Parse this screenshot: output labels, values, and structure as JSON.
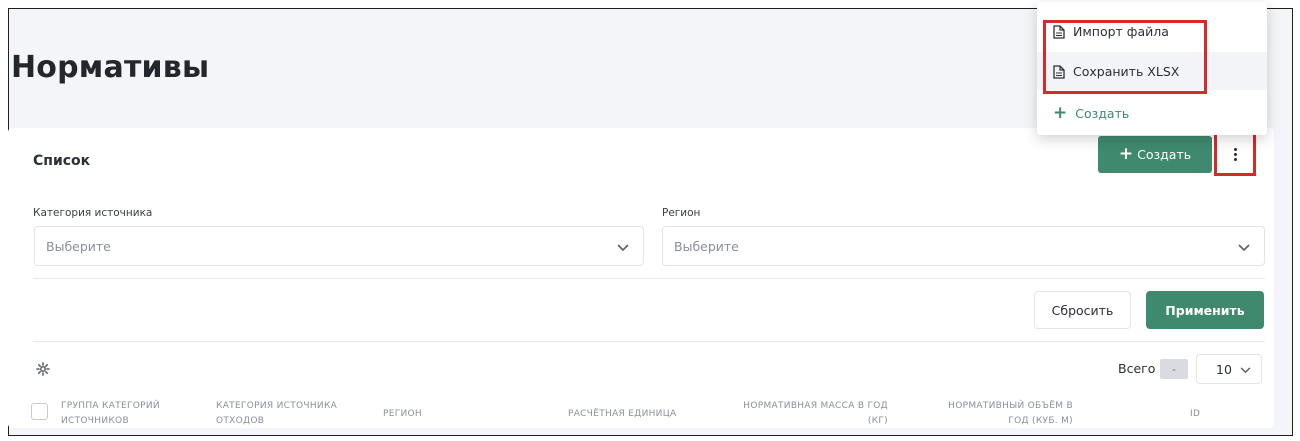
{
  "page": {
    "title": "Нормативы"
  },
  "card": {
    "list_title": "Список",
    "create_button": "Создать",
    "kebab_icon": "vertical-dots-icon"
  },
  "dropdown": {
    "items": [
      {
        "label": "Импорт файла",
        "icon": "file-icon"
      },
      {
        "label": "Сохранить XLSX",
        "icon": "file-icon"
      },
      {
        "label": "Создать",
        "icon": "plus-icon"
      }
    ]
  },
  "filters": {
    "source_category": {
      "label": "Категория источника",
      "placeholder": "Выберите"
    },
    "region": {
      "label": "Регион",
      "placeholder": "Выберите"
    },
    "reset_button": "Сбросить",
    "apply_button": "Применить"
  },
  "table": {
    "total_label": "Всего",
    "total_count": "-",
    "page_size": "10",
    "columns": [
      {
        "line1": "группа категорий",
        "line2": "источников"
      },
      {
        "line1": "категория источника",
        "line2": "отходов"
      },
      {
        "line1": "регион",
        "line2": ""
      },
      {
        "line1": "расчётная единица",
        "line2": ""
      },
      {
        "line1": "нормативная масса в год",
        "line2": "(кг)"
      },
      {
        "line1": "нормативный объём в",
        "line2": "год (куб. м)"
      },
      {
        "line1": "id",
        "line2": ""
      }
    ]
  },
  "colors": {
    "accent": "#3f8a6f",
    "highlight": "#d52a2a",
    "background": "#f4f5f8"
  }
}
